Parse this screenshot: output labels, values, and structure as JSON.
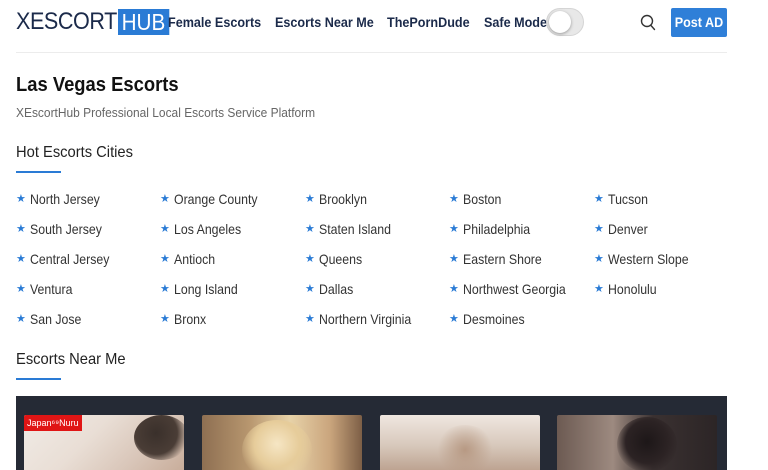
{
  "header": {
    "logo_part1": "XESCORT",
    "logo_part2": "HUB",
    "nav": [
      "Female Escorts",
      "Escorts Near Me",
      "ThePornDude"
    ],
    "safe_mode_label": "Safe Mode:",
    "safe_mode_on": false,
    "search_icon": "search-icon",
    "post_ad_label": "Post AD"
  },
  "main": {
    "title": "Las Vegas Escorts",
    "subtitle": "XEscortHub Professional Local Escorts Service Platform",
    "hot_cities_title": "Hot Escorts Cities",
    "cities": [
      [
        "North Jersey",
        "Orange County",
        "Brooklyn",
        "Boston",
        "Tucson"
      ],
      [
        "South Jersey",
        "Los Angeles",
        "Staten Island",
        "Philadelphia",
        "Denver"
      ],
      [
        "Central Jersey",
        "Antioch",
        "Queens",
        "Eastern Shore",
        "Western Slope"
      ],
      [
        "Ventura",
        "Long Island",
        "Dallas",
        "Northwest Georgia",
        "Honolulu"
      ],
      [
        "San Jose",
        "Bronx",
        "Northern Virginia",
        "Desmoines"
      ]
    ],
    "city_icon": "star-icon",
    "near_me_title": "Escorts Near Me",
    "cards": [
      {
        "badge": "Japan⁶⁹Nuru"
      },
      {
        "badge": ""
      },
      {
        "badge": ""
      },
      {
        "badge": ""
      }
    ]
  },
  "colors": {
    "accent": "#2a7bd5",
    "brand_dark": "#1b2a4a",
    "gallery_bg": "#252a35",
    "badge_red": "#e01515"
  }
}
